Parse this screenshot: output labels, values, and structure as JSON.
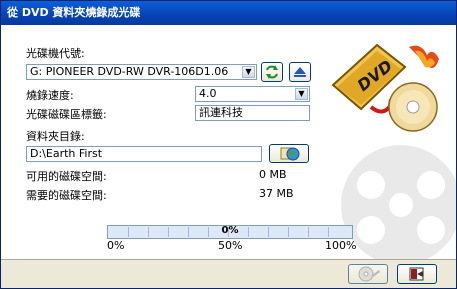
{
  "title": "從 DVD 資料夾燒錄成光碟",
  "drive": {
    "label": "光碟機代號:",
    "value": "G: PIONEER DVD-RW  DVR-106D1.06"
  },
  "speed": {
    "label": "燒錄速度:",
    "value": "4.0"
  },
  "volume": {
    "label": "光碟磁碟區標籤:",
    "value": "訊連科技"
  },
  "folder": {
    "label": "資料夾目錄:",
    "value": "D:\\Earth First"
  },
  "space": {
    "available_label": "可用的磁碟空間:",
    "available_value": "0 MB",
    "required_label": "需要的磁碟空間:",
    "required_value": "37 MB"
  },
  "progress": {
    "text": "0%",
    "value": 0,
    "scale_start": "0%",
    "scale_mid": "50%",
    "scale_end": "100%"
  },
  "colors": {
    "titlebar": "#0742b5",
    "progress": "#3e72cf",
    "dvd_gold": "#e0a826",
    "refresh_green": "#1d8f2a"
  },
  "icons": {
    "refresh": "refresh-icon",
    "eject": "eject-icon",
    "browse": "browse-folder-icon",
    "burn": "burn-disc-icon",
    "exit": "exit-icon",
    "logo": "dvd-logo-icon"
  }
}
